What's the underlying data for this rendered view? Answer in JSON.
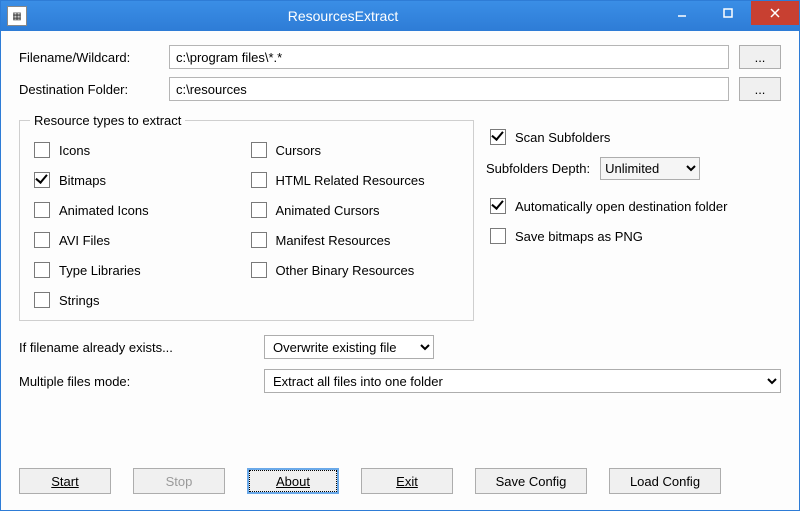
{
  "window": {
    "title": "ResourcesExtract"
  },
  "labels": {
    "filename": "Filename/Wildcard:",
    "destination": "Destination Folder:",
    "resource_legend": "Resource types to extract",
    "scan_subfolders": "Scan Subfolders",
    "subfolders_depth": "Subfolders Depth:",
    "auto_open": "Automatically open destination folder",
    "save_png": "Save bitmaps as PNG",
    "if_exists": "If filename already exists...",
    "multi_mode": "Multiple files mode:"
  },
  "inputs": {
    "filename": "c:\\program files\\*.*",
    "destination": "c:\\resources",
    "browse": "..."
  },
  "resource_types": {
    "left": [
      {
        "key": "icons",
        "label": "Icons",
        "checked": false
      },
      {
        "key": "bitmaps",
        "label": "Bitmaps",
        "checked": true
      },
      {
        "key": "anim_icons",
        "label": "Animated Icons",
        "checked": false
      },
      {
        "key": "avi",
        "label": "AVI Files",
        "checked": false
      },
      {
        "key": "typelib",
        "label": "Type Libraries",
        "checked": false
      },
      {
        "key": "strings",
        "label": "Strings",
        "checked": false
      }
    ],
    "right": [
      {
        "key": "cursors",
        "label": "Cursors",
        "checked": false
      },
      {
        "key": "html",
        "label": "HTML Related Resources",
        "checked": false
      },
      {
        "key": "anim_cursors",
        "label": "Animated Cursors",
        "checked": false
      },
      {
        "key": "manifest",
        "label": "Manifest Resources",
        "checked": false
      },
      {
        "key": "other_bin",
        "label": "Other Binary Resources",
        "checked": false
      }
    ]
  },
  "options": {
    "scan_subfolders": true,
    "depth_value": "Unlimited",
    "auto_open": true,
    "save_png": false
  },
  "selects": {
    "if_exists": "Overwrite existing file",
    "multi_mode": "Extract all files into one folder"
  },
  "buttons": {
    "start": "Start",
    "stop": "Stop",
    "about": "About",
    "exit": "Exit",
    "save_config": "Save Config",
    "load_config": "Load Config"
  }
}
